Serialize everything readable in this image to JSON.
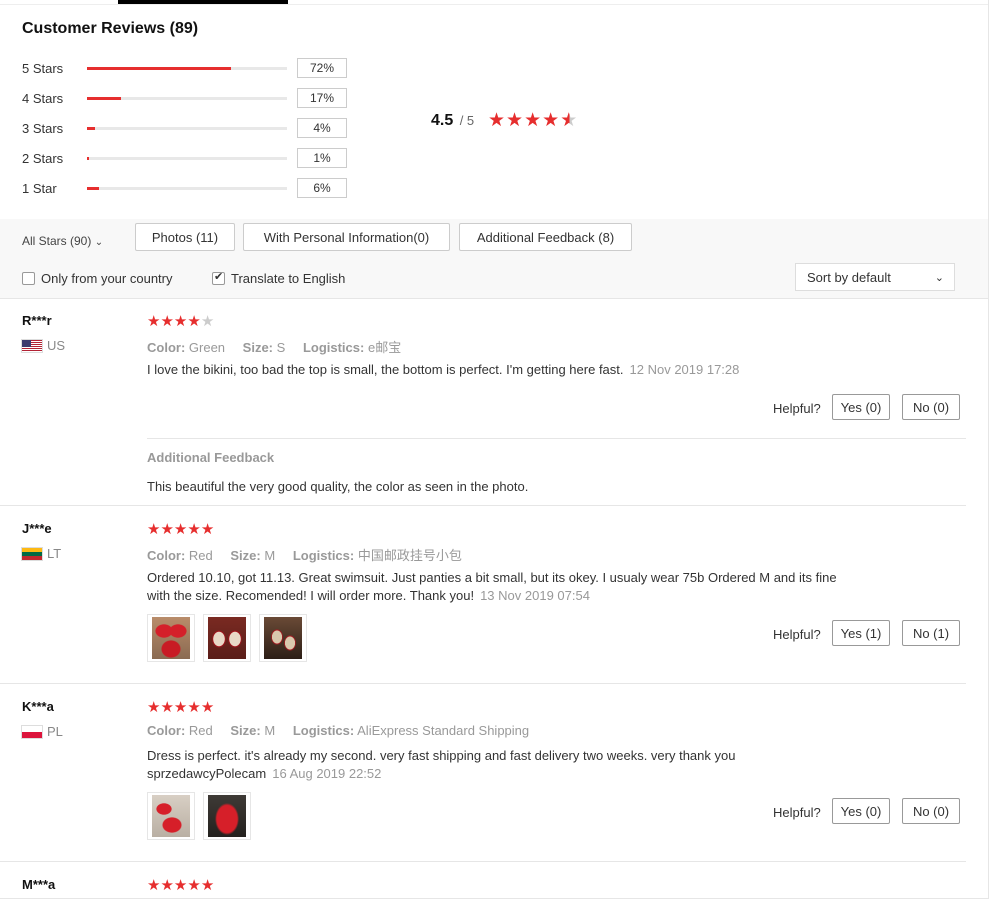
{
  "header": {
    "title": "Customer Reviews (89)"
  },
  "histogram": [
    {
      "label": "5 Stars",
      "pct": "72%",
      "value": 72
    },
    {
      "label": "4 Stars",
      "pct": "17%",
      "value": 17
    },
    {
      "label": "3 Stars",
      "pct": "4%",
      "value": 4
    },
    {
      "label": "2 Stars",
      "pct": "1%",
      "value": 1
    },
    {
      "label": "1 Star",
      "pct": "6%",
      "value": 6
    }
  ],
  "summary": {
    "score": "4.5",
    "out_of": "/ 5",
    "rating": 4.5
  },
  "filters": {
    "all_stars": "All Stars (90)",
    "photos": "Photos (11)",
    "personal": "With Personal Information(0)",
    "additional": "Additional Feedback (8)",
    "only_country": "Only from your country",
    "translate": "Translate to English",
    "sort": "Sort by default"
  },
  "colors": {
    "accent": "#e62e2e"
  },
  "labels": {
    "color": "Color:",
    "size": "Size:",
    "logistics": "Logistics:",
    "helpful": "Helpful?",
    "additional_feedback": "Additional Feedback"
  },
  "reviews": [
    {
      "user": "R***r",
      "country": "US",
      "stars": 4,
      "color": "Green",
      "size": "S",
      "logistics": "e邮宝",
      "text": "I love the bikini, too bad the top is small, the bottom is perfect. I'm getting here fast.",
      "date": "12 Nov 2019 17:28",
      "yes": "Yes (0)",
      "no": "No (0)",
      "additional_feedback": "This beautiful the very good quality, the color as seen in the photo."
    },
    {
      "user": "J***e",
      "country": "LT",
      "stars": 5,
      "color": "Red",
      "size": "M",
      "logistics": "中国邮政挂号小包",
      "text_line1": "Ordered 10.10, got 11.13. Great swimsuit. Just panties a bit small, but its okey. I usualy wear 75b Ordered M and its fine",
      "text_line2": "with the size. Recomended! I will order more. Thank you!",
      "date": "13 Nov 2019 07:54",
      "yes": "Yes (1)",
      "no": "No (1)"
    },
    {
      "user": "K***a",
      "country": "PL",
      "stars": 5,
      "color": "Red",
      "size": "M",
      "logistics": "AliExpress Standard Shipping",
      "text_line1": "Dress is perfect. it's already my second. very fast shipping and fast delivery two weeks. very thank you",
      "text_line2": "sprzedawcyPolecam",
      "date": "16 Aug 2019 22:52",
      "yes": "Yes (0)",
      "no": "No (0)"
    },
    {
      "user": "M***a",
      "stars": 5
    }
  ]
}
